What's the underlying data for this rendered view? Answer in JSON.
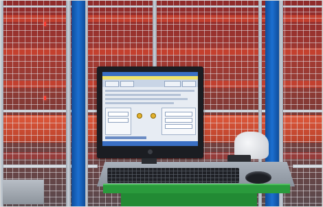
{
  "scene": {
    "description_label": "",
    "colors": {
      "rack_red": "#c8412f",
      "post_blue": "#1c6fd0",
      "desk_green": "#2a9a3c",
      "mesh": "#e6e6eb"
    },
    "icons": [
      "monitor-icon",
      "keyboard-icon",
      "mouse-icon",
      "scanner-icon"
    ]
  }
}
